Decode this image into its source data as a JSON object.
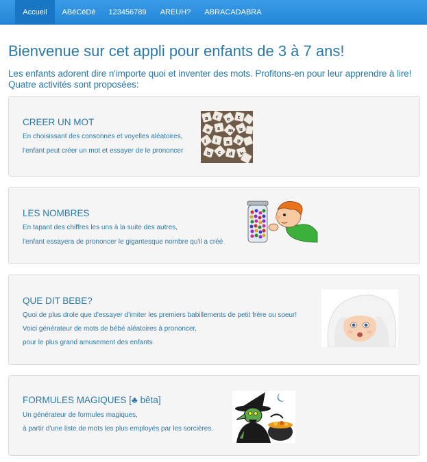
{
  "nav": {
    "items": [
      {
        "label": "Accueil",
        "active": true
      },
      {
        "label": "ABéCéDé"
      },
      {
        "label": "123456789"
      },
      {
        "label": "AREUH?"
      },
      {
        "label": "ABRACADABRA"
      }
    ]
  },
  "page": {
    "title": "Bienvenue sur cet appli pour enfants de 3 à 7 ans!",
    "intro_line1": "Les enfants adorent dire n'importe quoi et inventer des mots. Profitons-en pour leur apprendre à lire!",
    "intro_line2": "Quatre activités sont proposées:"
  },
  "activities": [
    {
      "title": "CREER UN MOT",
      "lines": [
        "En choisissant des consonnes et voyelles aléatoires,",
        "l'enfant peut créer un mot et essayer de le prononcer"
      ],
      "image": "letter-tiles-image"
    },
    {
      "title": "LES NOMBRES",
      "lines": [
        "En tapant des chiffres les uns à la suite des autres,",
        "l'enfant essayera de prononcer le gigantesque nombre qu'il a créé"
      ],
      "image": "boy-with-candy-jar-image"
    },
    {
      "title": "QUE DIT BEBE?",
      "lines": [
        "Quoi de plus drole que d'essayer d'imiter les premiers babillements de petit frère ou soeur!",
        "Voici générateur de mots de bébé aléatoires à prononcer,",
        "pour le plus grand amusement des enfants."
      ],
      "image": "baby-in-towel-image"
    },
    {
      "title": "FORMULES MAGIQUES [♣ bêta]",
      "lines": [
        "Un générateur de formules magiques,",
        "à partir d'une liste de mots les plus employés par les sorcières."
      ],
      "image": "witch-with-cauldron-image"
    }
  ],
  "colors": {
    "navbar": "#2387d9",
    "nav_active": "#1976c4",
    "text_primary": "#2a79a8",
    "card_bg": "#f5f5f5",
    "card_border": "#dcdcdc"
  }
}
